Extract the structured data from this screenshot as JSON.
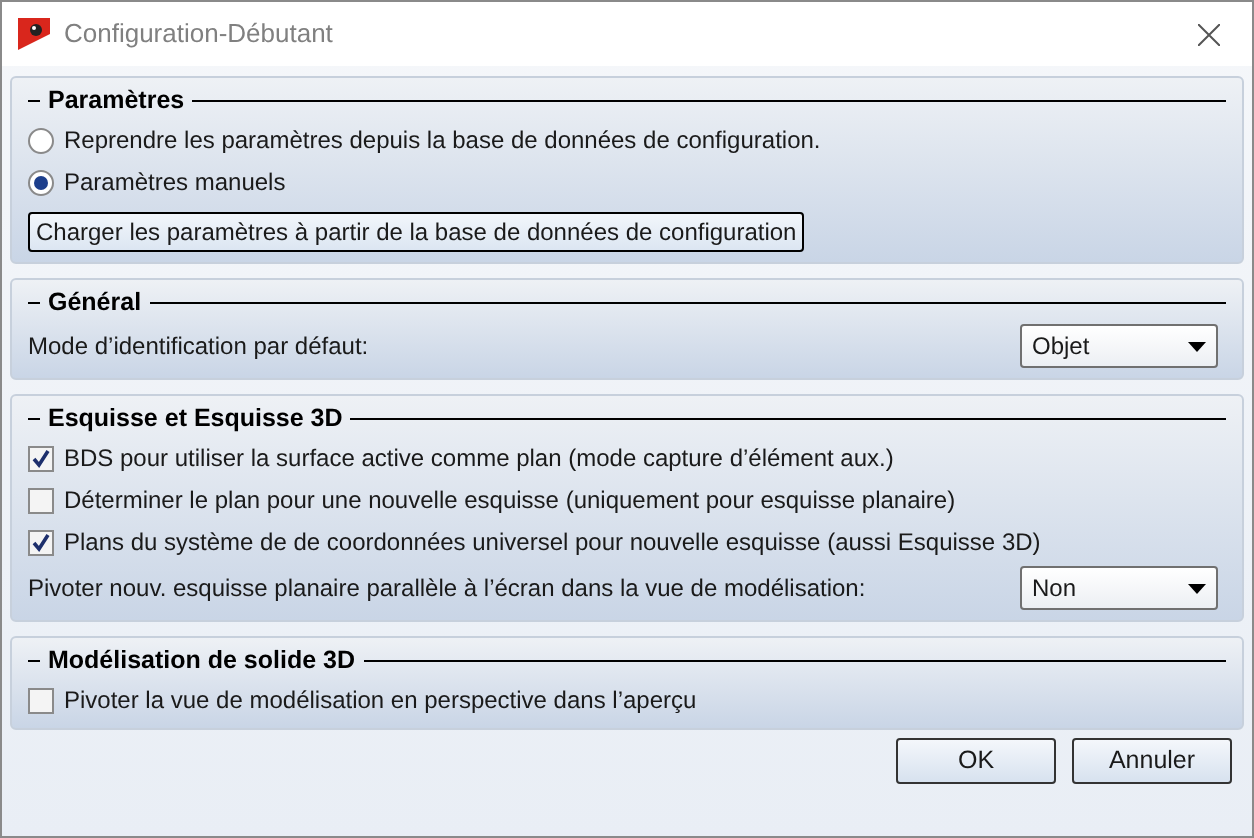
{
  "window": {
    "title": "Configuration-Débutant"
  },
  "sections": [
    {
      "title": "Paramètres",
      "items": [
        {
          "kind": "radio",
          "label": "Reprendre les paramètres depuis la base de données de configuration.",
          "selected": false
        },
        {
          "kind": "radio",
          "label": "Paramètres manuels",
          "selected": true
        },
        {
          "kind": "button",
          "label": "Charger les paramètres à partir de la base de données de configuration"
        }
      ]
    },
    {
      "title": "Général",
      "items": [
        {
          "kind": "select",
          "label": "Mode d’identification par défaut:",
          "value": "Objet"
        }
      ]
    },
    {
      "title": "Esquisse et Esquisse 3D",
      "items": [
        {
          "kind": "checkbox",
          "label": "BDS pour utiliser la surface active comme plan (mode capture d’élément aux.)",
          "checked": true
        },
        {
          "kind": "checkbox",
          "label": "Déterminer le plan pour une nouvelle esquisse (uniquement pour esquisse planaire)",
          "checked": false
        },
        {
          "kind": "checkbox",
          "label": "Plans du système de de coordonnées universel pour nouvelle esquisse (aussi Esquisse 3D)",
          "checked": true
        },
        {
          "kind": "select",
          "label": "Pivoter nouv. esquisse planaire parallèle à l’écran dans la vue de modélisation:",
          "value": "Non"
        }
      ]
    },
    {
      "title": "Modélisation de solide 3D",
      "items": [
        {
          "kind": "checkbox",
          "label": "Pivoter la vue de modélisation en perspective dans l’aperçu",
          "checked": false
        }
      ]
    }
  ],
  "buttons": [
    "OK",
    "Annuler"
  ]
}
